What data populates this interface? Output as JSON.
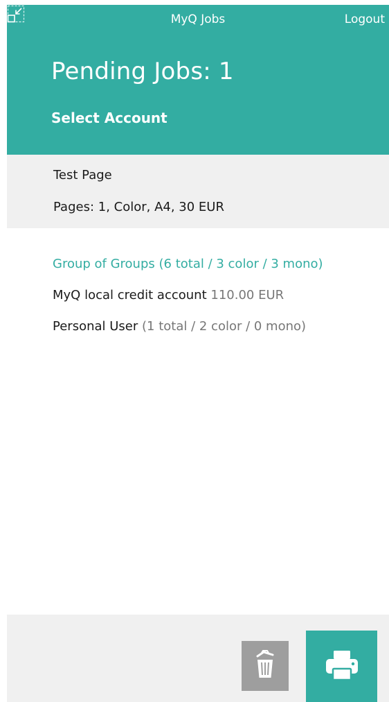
{
  "header": {
    "app_title": "MyQ Jobs",
    "logout_label": "Logout",
    "page_title": "Pending Jobs: 1",
    "subtitle": "Select Account"
  },
  "job": {
    "name": "Test Page",
    "details": "Pages: 1, Color, A4, 30 EUR"
  },
  "accounts": [
    {
      "name": "Group of Groups (6 total / 3 color / 3 mono)",
      "detail": "",
      "selected": true
    },
    {
      "name": "MyQ local credit account",
      "detail": "110.00 EUR",
      "selected": false
    },
    {
      "name": "Personal User",
      "detail": "(1 total / 2 color / 0 mono)",
      "selected": false
    }
  ],
  "icons": {
    "minimize": "minimize-icon",
    "delete": "trash-icon",
    "print": "printer-icon"
  },
  "colors": {
    "accent": "#33ada2",
    "header_text": "#ffffff",
    "panel_background": "#f0f0f0",
    "muted_text": "#777777",
    "delete_button": "#9e9e9e"
  }
}
